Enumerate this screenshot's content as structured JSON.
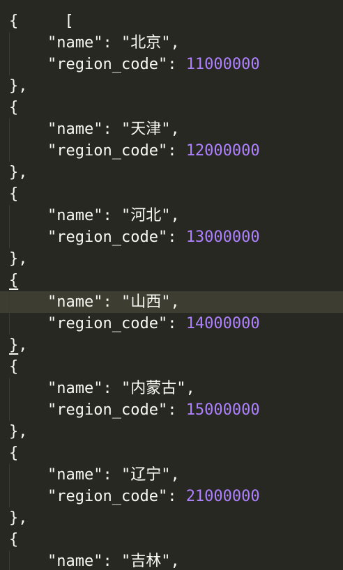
{
  "editor": {
    "open_bracket": "[",
    "active_entry_index": 3,
    "entries": [
      {
        "name_key": "\"name\"",
        "name_value": "\"北京\"",
        "code_key": "\"region_code\"",
        "code_value": "11000000"
      },
      {
        "name_key": "\"name\"",
        "name_value": "\"天津\"",
        "code_key": "\"region_code\"",
        "code_value": "12000000"
      },
      {
        "name_key": "\"name\"",
        "name_value": "\"河北\"",
        "code_key": "\"region_code\"",
        "code_value": "13000000"
      },
      {
        "name_key": "\"name\"",
        "name_value": "\"山西\"",
        "code_key": "\"region_code\"",
        "code_value": "14000000"
      },
      {
        "name_key": "\"name\"",
        "name_value": "\"内蒙古\"",
        "code_key": "\"region_code\"",
        "code_value": "15000000"
      },
      {
        "name_key": "\"name\"",
        "name_value": "\"辽宁\"",
        "code_key": "\"region_code\"",
        "code_value": "21000000"
      },
      {
        "name_key": "\"name\"",
        "name_value": "\"吉林\""
      }
    ]
  },
  "colors": {
    "background": "#272822",
    "active_line": "#3e3d32",
    "text": "#f8f8f2",
    "number": "#ae81ff"
  }
}
